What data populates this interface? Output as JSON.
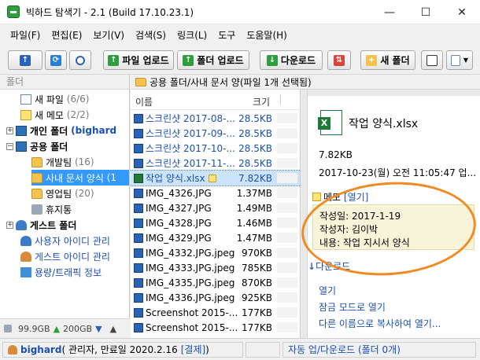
{
  "window": {
    "title": "빅하드 탐색기 - 2.1 (Build 17.10.23.1)",
    "minimize": "—",
    "maximize": "☐",
    "close": "✕"
  },
  "menu": [
    "파일(F)",
    "편집(E)",
    "보기(V)",
    "검색(S)",
    "링크(L)",
    "도구",
    "도움말(H)"
  ],
  "toolbar": {
    "file_upload": "파일 업로드",
    "folder_upload": "폴더 업로드",
    "download": "다운로드",
    "new_folder": "새 폴더"
  },
  "left": {
    "header": "폴더",
    "items": {
      "new_files": {
        "label": "새 파일",
        "count": "(6/6)"
      },
      "new_memo": {
        "label": "새 메모",
        "count": "(2/2)"
      },
      "personal": "개인 폴더",
      "personal_user": "(bighard",
      "shared": "공용 폴더",
      "dev_team": {
        "label": "개발팀",
        "count": "(16)"
      },
      "doc_form": {
        "label": "사내 문서 양식",
        "count": "(1"
      },
      "sales_team": {
        "label": "영업팀",
        "count": "(20)"
      },
      "trash": "휴지통",
      "guest": "게스트 폴더",
      "user_id": "사용자 아이디 관리",
      "guest_id": "게스트 아이디 관리",
      "capacity": "용량/트래픽 정보"
    },
    "footer": {
      "disk": "99.9GB",
      "traffic": "200GB"
    }
  },
  "path": "공용 폴더/사내 문서 양(파일 1개 선택됨)",
  "list": {
    "col_name": "이름",
    "col_size": "크기",
    "files": [
      {
        "name": "스크린샷 2017-08-...",
        "size": "28.5KB",
        "link": true
      },
      {
        "name": "스크린샷 2017-09-...",
        "size": "28.5KB",
        "link": true
      },
      {
        "name": "스크린샷 2017-10-...",
        "size": "28.5KB",
        "link": true
      },
      {
        "name": "스크린샷 2017-11-...",
        "size": "28.5KB",
        "link": true
      },
      {
        "name": "작업 양식.xlsx",
        "size": "7.82KB",
        "link": true,
        "selected": true
      },
      {
        "name": "IMG_4326.JPG",
        "size": "1.37MB"
      },
      {
        "name": "IMG_4327.JPG",
        "size": "1.49MB"
      },
      {
        "name": "IMG_4328.JPG",
        "size": "1.46MB"
      },
      {
        "name": "IMG_4329.JPG",
        "size": "1.47MB"
      },
      {
        "name": "IMG_4332.JPG.jpeg",
        "size": "970KB"
      },
      {
        "name": "IMG_4333.JPG.jpeg",
        "size": "785KB"
      },
      {
        "name": "IMG_4335.JPG.jpeg",
        "size": "870KB"
      },
      {
        "name": "IMG_4336.JPG.jpeg",
        "size": "925KB"
      },
      {
        "name": "Screenshot 2015-...",
        "size": "177KB"
      },
      {
        "name": "Screenshot 2015-...",
        "size": "177KB"
      }
    ]
  },
  "detail": {
    "filename": "작업 양식.xlsx",
    "size": "7.82KB",
    "date": "2017-10-23(월) 오전 11:05:47 업...",
    "memo_label": "메모",
    "memo_open": "[열기]",
    "memo_lines": [
      "작성일: 2017-1-19",
      "작성자: 김이박",
      "내용: 작업 지시서 양식"
    ],
    "download": "다운로드",
    "open": "열기",
    "lock_open": "잠금 모드로 열기",
    "copy_as": "다른 이름으로 복사하여 열기..."
  },
  "status": {
    "user": "bighard",
    "role": "( 관리자, 만료일 2020.2.16",
    "pay": "[결제]",
    "close_paren": ")",
    "auto": "자동 업/다운로드 (폴더 0개)"
  }
}
